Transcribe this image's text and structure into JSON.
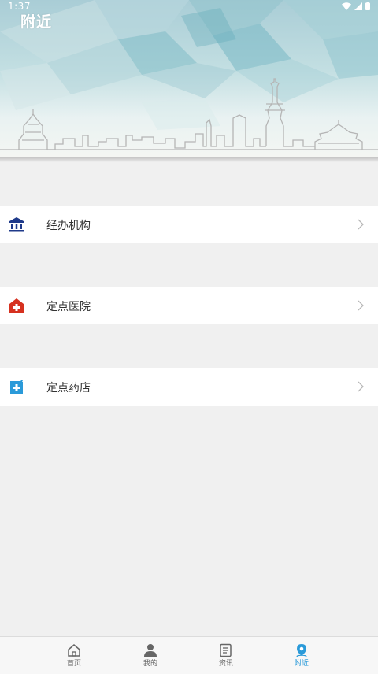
{
  "status_bar": {
    "time": "1:37",
    "icons": [
      "wifi-icon",
      "signal-icon",
      "battery-icon"
    ]
  },
  "header": {
    "title": "附近"
  },
  "menu": {
    "items": [
      {
        "label": "经办机构",
        "icon": "institution-building-icon",
        "icon_color": "#1f3a8a"
      },
      {
        "label": "定点医院",
        "icon": "hospital-cross-icon",
        "icon_color": "#d6311f"
      },
      {
        "label": "定点药店",
        "icon": "pharmacy-plus-icon",
        "icon_color": "#2a9ad9"
      }
    ]
  },
  "bottom_nav": {
    "items": [
      {
        "label": "首页",
        "icon": "home-icon",
        "active": false
      },
      {
        "label": "我的",
        "icon": "user-icon",
        "active": false
      },
      {
        "label": "资讯",
        "icon": "news-icon",
        "active": false
      },
      {
        "label": "附近",
        "icon": "location-pin-icon",
        "active": true
      }
    ]
  },
  "colors": {
    "accent": "#2a9ad9",
    "inactive": "#666666",
    "background": "#f0f0f0"
  }
}
